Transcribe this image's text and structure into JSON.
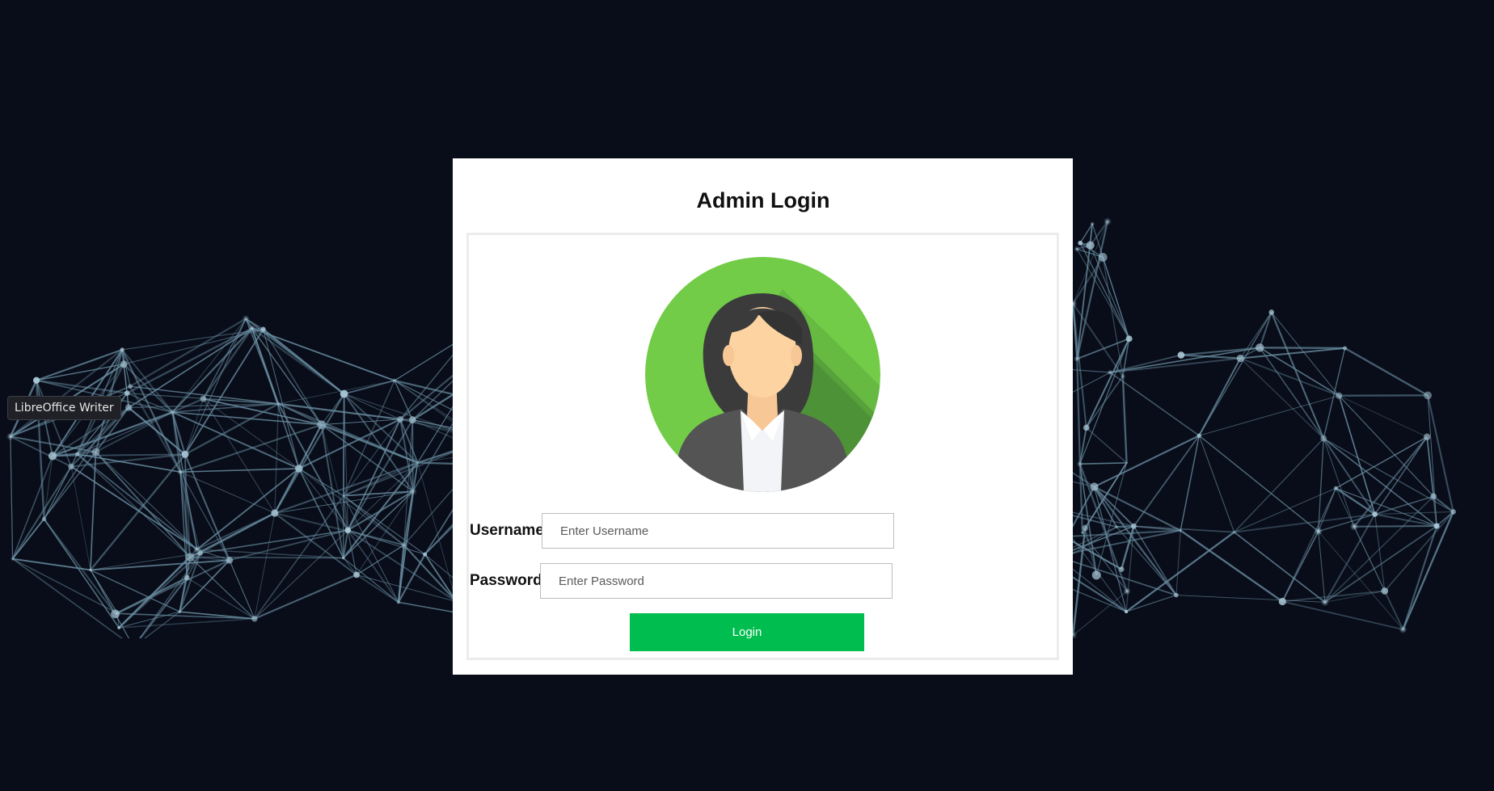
{
  "tooltip": {
    "text": "LibreOffice Writer"
  },
  "login": {
    "title": "Admin Login",
    "username_label": "Username",
    "username_placeholder": "Enter Username",
    "username_value": "",
    "password_label": "Password",
    "password_placeholder": "Enter Password",
    "password_value": "",
    "button_label": "Login"
  },
  "colors": {
    "page_background": "#090d19",
    "network_lines": "#6a8fa3",
    "card_background": "#ffffff",
    "button_background": "#00bd4f",
    "avatar_circle": "#6cc94a"
  },
  "icons": {
    "avatar": "female-user-avatar-icon"
  }
}
